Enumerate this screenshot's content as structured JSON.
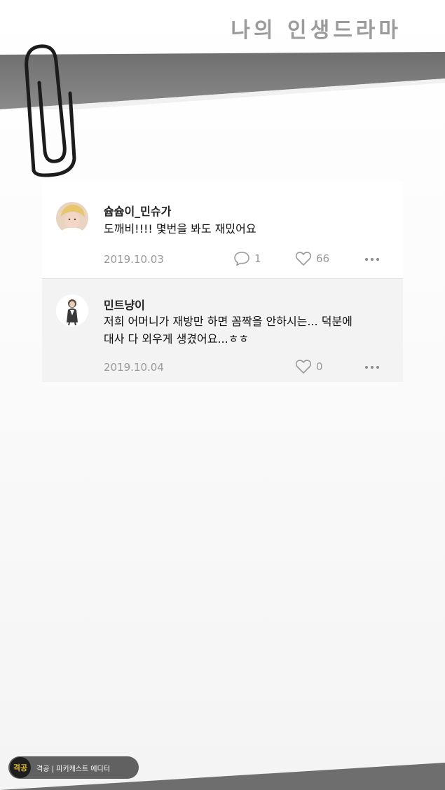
{
  "page": {
    "title": "나의 인생드라마"
  },
  "comments": [
    {
      "username": "슙슙이_민슈가",
      "text": "도깨비!!!! 몇번을 봐도 재밌어요",
      "date": "2019.10.03",
      "replies": "1",
      "likes": "66",
      "avatar_icon": "user-avatar-photo"
    },
    {
      "username": "민트냥이",
      "text_line1": "저희 어머니가 재방만 하면 꼼짝을 안하시는... 덕분에",
      "text_line2": "대사 다 외우게 생겼어요...ㅎㅎ",
      "date": "2019.10.04",
      "likes": "0",
      "avatar_icon": "user-avatar-illustration"
    }
  ],
  "badge": {
    "logo": "격공",
    "text": "격공 | 피키캐스트 에디터"
  },
  "colors": {
    "tape": "#7a7a7a",
    "card_bg": "#ffffff",
    "reply_bg": "#f3f3f3",
    "meta_text": "#9a9a9a"
  }
}
